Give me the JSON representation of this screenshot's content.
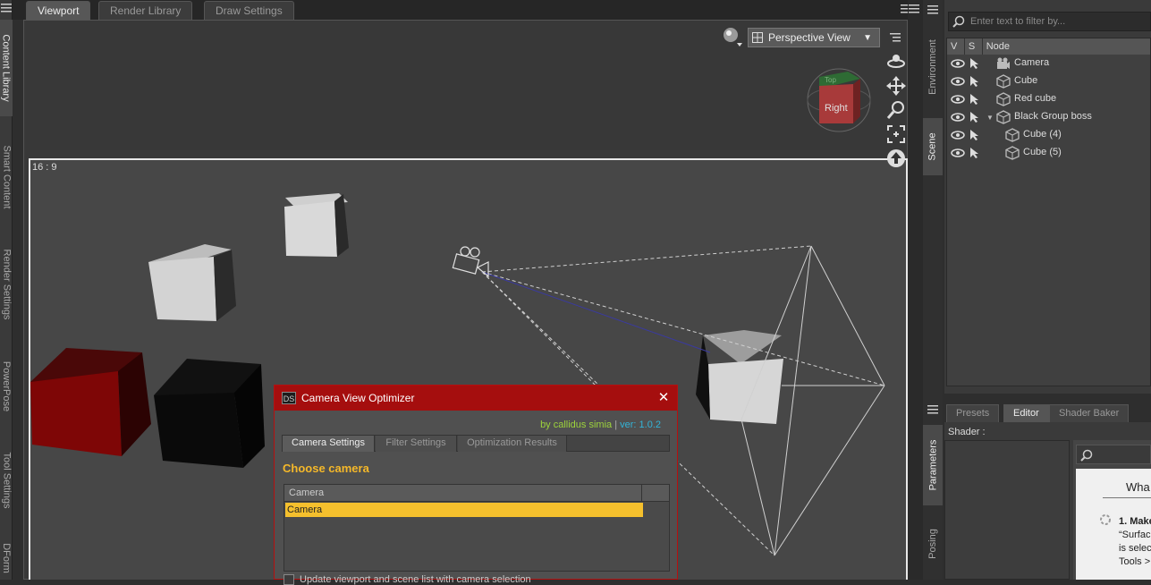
{
  "left_tabs": [
    "Content Library",
    "Smart Content",
    "Render Settings",
    "PowerPose",
    "Tool Settings",
    "DForm"
  ],
  "top_tabs": [
    "Viewport",
    "Render Library",
    "Draw Settings"
  ],
  "viewport": {
    "aspect_label": "16 : 9",
    "view_select": "Perspective View",
    "gizmo_label": "Right",
    "gizmo_top_label": "Top"
  },
  "dialog": {
    "title": "Camera View Optimizer",
    "logo": "DS",
    "credit_author": "by callidus simia",
    "credit_sep": "|",
    "credit_version": "ver: 1.0.2",
    "tabs": [
      "Camera Settings",
      "Filter Settings",
      "Optimization Results"
    ],
    "heading": "Choose camera",
    "table_header": "Camera",
    "rows": [
      "Camera"
    ],
    "checkbox_label": "Update viewport and scene list with camera selection"
  },
  "right_vtabs": [
    "Environment",
    "Scene",
    "Parameters",
    "Posing"
  ],
  "scene": {
    "filter_placeholder": "Enter text to filter by...",
    "columns": [
      "V",
      "S",
      "Node"
    ],
    "nodes": [
      "Camera",
      "Cube",
      "Red cube",
      "Black Group boss",
      "Cube (4)",
      "Cube (5)"
    ]
  },
  "bottom": {
    "tabs": [
      "Presets",
      "Editor",
      "Shader Baker"
    ],
    "shader_label": "Shader :",
    "doc_title": "Wha",
    "doc_lines": [
      "1. Make",
      "“Surfac",
      "is selec",
      "Tools >"
    ]
  }
}
